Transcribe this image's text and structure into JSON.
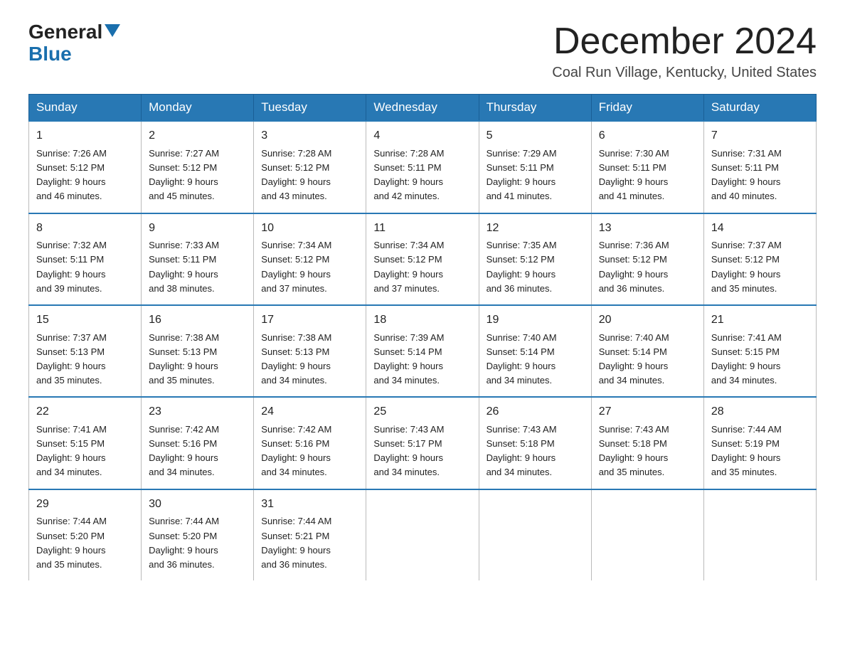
{
  "header": {
    "logo_general": "General",
    "logo_blue": "Blue",
    "month": "December 2024",
    "location": "Coal Run Village, Kentucky, United States"
  },
  "weekdays": [
    "Sunday",
    "Monday",
    "Tuesday",
    "Wednesday",
    "Thursday",
    "Friday",
    "Saturday"
  ],
  "weeks": [
    [
      {
        "day": "1",
        "sunrise": "7:26 AM",
        "sunset": "5:12 PM",
        "daylight": "9 hours and 46 minutes."
      },
      {
        "day": "2",
        "sunrise": "7:27 AM",
        "sunset": "5:12 PM",
        "daylight": "9 hours and 45 minutes."
      },
      {
        "day": "3",
        "sunrise": "7:28 AM",
        "sunset": "5:12 PM",
        "daylight": "9 hours and 43 minutes."
      },
      {
        "day": "4",
        "sunrise": "7:28 AM",
        "sunset": "5:11 PM",
        "daylight": "9 hours and 42 minutes."
      },
      {
        "day": "5",
        "sunrise": "7:29 AM",
        "sunset": "5:11 PM",
        "daylight": "9 hours and 41 minutes."
      },
      {
        "day": "6",
        "sunrise": "7:30 AM",
        "sunset": "5:11 PM",
        "daylight": "9 hours and 41 minutes."
      },
      {
        "day": "7",
        "sunrise": "7:31 AM",
        "sunset": "5:11 PM",
        "daylight": "9 hours and 40 minutes."
      }
    ],
    [
      {
        "day": "8",
        "sunrise": "7:32 AM",
        "sunset": "5:11 PM",
        "daylight": "9 hours and 39 minutes."
      },
      {
        "day": "9",
        "sunrise": "7:33 AM",
        "sunset": "5:11 PM",
        "daylight": "9 hours and 38 minutes."
      },
      {
        "day": "10",
        "sunrise": "7:34 AM",
        "sunset": "5:12 PM",
        "daylight": "9 hours and 37 minutes."
      },
      {
        "day": "11",
        "sunrise": "7:34 AM",
        "sunset": "5:12 PM",
        "daylight": "9 hours and 37 minutes."
      },
      {
        "day": "12",
        "sunrise": "7:35 AM",
        "sunset": "5:12 PM",
        "daylight": "9 hours and 36 minutes."
      },
      {
        "day": "13",
        "sunrise": "7:36 AM",
        "sunset": "5:12 PM",
        "daylight": "9 hours and 36 minutes."
      },
      {
        "day": "14",
        "sunrise": "7:37 AM",
        "sunset": "5:12 PM",
        "daylight": "9 hours and 35 minutes."
      }
    ],
    [
      {
        "day": "15",
        "sunrise": "7:37 AM",
        "sunset": "5:13 PM",
        "daylight": "9 hours and 35 minutes."
      },
      {
        "day": "16",
        "sunrise": "7:38 AM",
        "sunset": "5:13 PM",
        "daylight": "9 hours and 35 minutes."
      },
      {
        "day": "17",
        "sunrise": "7:38 AM",
        "sunset": "5:13 PM",
        "daylight": "9 hours and 34 minutes."
      },
      {
        "day": "18",
        "sunrise": "7:39 AM",
        "sunset": "5:14 PM",
        "daylight": "9 hours and 34 minutes."
      },
      {
        "day": "19",
        "sunrise": "7:40 AM",
        "sunset": "5:14 PM",
        "daylight": "9 hours and 34 minutes."
      },
      {
        "day": "20",
        "sunrise": "7:40 AM",
        "sunset": "5:14 PM",
        "daylight": "9 hours and 34 minutes."
      },
      {
        "day": "21",
        "sunrise": "7:41 AM",
        "sunset": "5:15 PM",
        "daylight": "9 hours and 34 minutes."
      }
    ],
    [
      {
        "day": "22",
        "sunrise": "7:41 AM",
        "sunset": "5:15 PM",
        "daylight": "9 hours and 34 minutes."
      },
      {
        "day": "23",
        "sunrise": "7:42 AM",
        "sunset": "5:16 PM",
        "daylight": "9 hours and 34 minutes."
      },
      {
        "day": "24",
        "sunrise": "7:42 AM",
        "sunset": "5:16 PM",
        "daylight": "9 hours and 34 minutes."
      },
      {
        "day": "25",
        "sunrise": "7:43 AM",
        "sunset": "5:17 PM",
        "daylight": "9 hours and 34 minutes."
      },
      {
        "day": "26",
        "sunrise": "7:43 AM",
        "sunset": "5:18 PM",
        "daylight": "9 hours and 34 minutes."
      },
      {
        "day": "27",
        "sunrise": "7:43 AM",
        "sunset": "5:18 PM",
        "daylight": "9 hours and 35 minutes."
      },
      {
        "day": "28",
        "sunrise": "7:44 AM",
        "sunset": "5:19 PM",
        "daylight": "9 hours and 35 minutes."
      }
    ],
    [
      {
        "day": "29",
        "sunrise": "7:44 AM",
        "sunset": "5:20 PM",
        "daylight": "9 hours and 35 minutes."
      },
      {
        "day": "30",
        "sunrise": "7:44 AM",
        "sunset": "5:20 PM",
        "daylight": "9 hours and 36 minutes."
      },
      {
        "day": "31",
        "sunrise": "7:44 AM",
        "sunset": "5:21 PM",
        "daylight": "9 hours and 36 minutes."
      },
      null,
      null,
      null,
      null
    ]
  ]
}
